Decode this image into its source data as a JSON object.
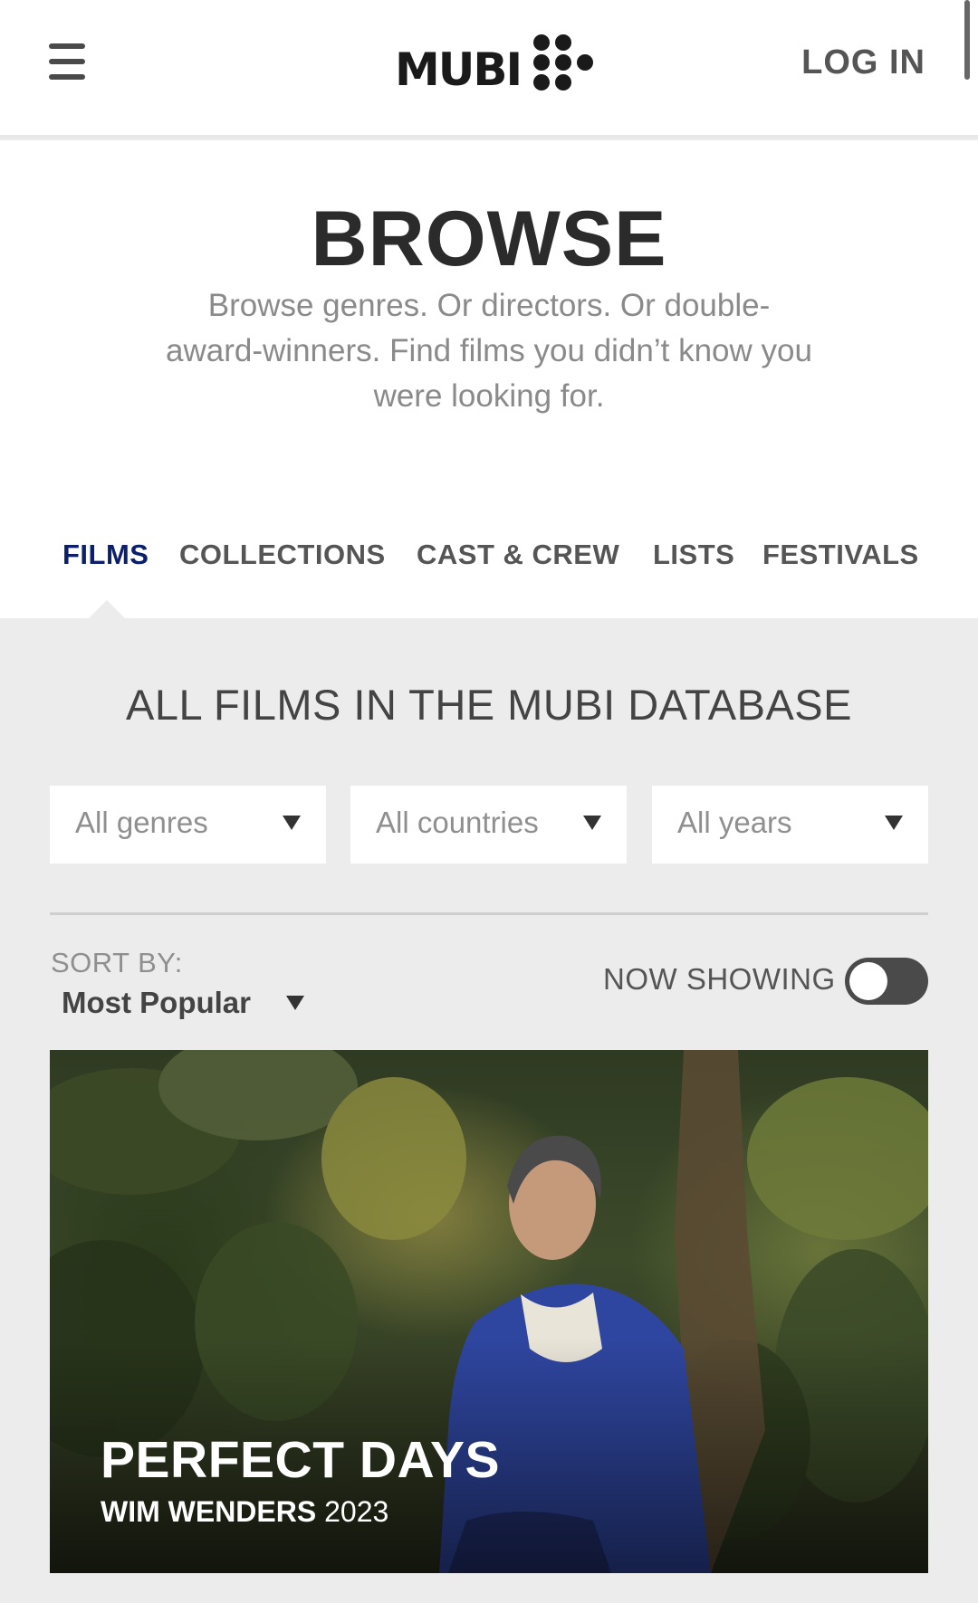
{
  "header": {
    "logo_text": "MUBI",
    "login_label": "LOG IN"
  },
  "intro": {
    "title": "BROWSE",
    "subtitle": "Browse genres. Or directors. Or double-award-winners. Find films you didn’t know you were looking for."
  },
  "tabs": [
    {
      "label": "FILMS",
      "active": true
    },
    {
      "label": "COLLECTIONS",
      "active": false
    },
    {
      "label": "CAST & CREW",
      "active": false
    },
    {
      "label": "LISTS",
      "active": false
    },
    {
      "label": "FESTIVALS",
      "active": false
    }
  ],
  "films": {
    "heading": "ALL FILMS IN THE MUBI DATABASE",
    "filters": {
      "genre": "All genres",
      "country": "All countries",
      "year": "All years"
    },
    "sort": {
      "label": "SORT BY:",
      "value": "Most Popular"
    },
    "now_showing": {
      "label": "NOW SHOWING",
      "enabled": false
    },
    "featured": {
      "title": "PERFECT DAYS",
      "director": "WIM WENDERS",
      "year": "2023"
    }
  },
  "colors": {
    "active_tab": "#0b1f6a",
    "text_dark": "#2b2b2b",
    "panel_bg": "#ececec"
  }
}
